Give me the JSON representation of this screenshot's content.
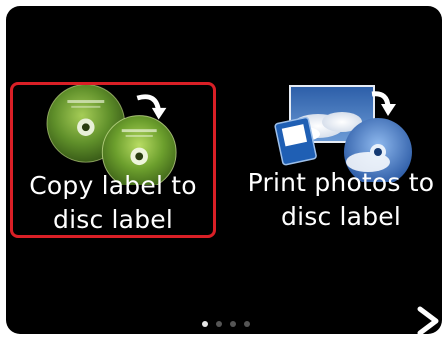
{
  "menu": {
    "items": [
      {
        "line1": "Copy label to",
        "line2": "disc label",
        "icon": "copy-disc-icon",
        "selected": true
      },
      {
        "line1": "Print photos to",
        "line2": "disc label",
        "icon": "photo-disc-icon",
        "selected": false
      }
    ]
  },
  "pager": {
    "page_count": 4,
    "current_page": 1
  },
  "colors": {
    "selection_border": "#d91f26",
    "background": "#000000"
  }
}
